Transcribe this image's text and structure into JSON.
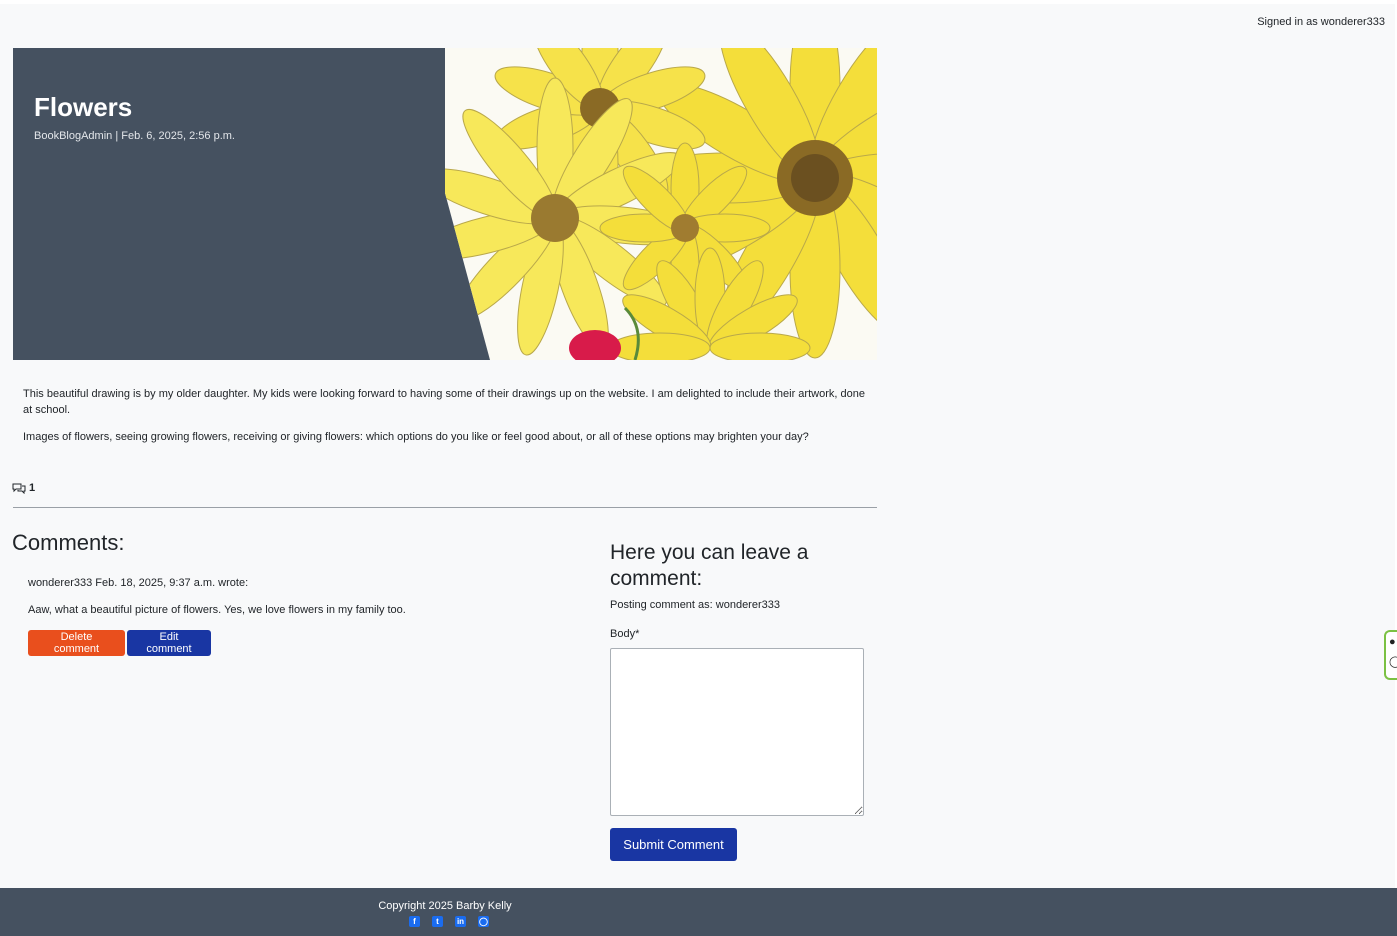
{
  "header": {
    "signed_in": "Signed in as wonderer333"
  },
  "post": {
    "title": "Flowers",
    "meta": "BookBlogAdmin | Feb. 6, 2025, 2:56 p.m.",
    "paragraphs": [
      "This beautiful drawing is by my older daughter. My kids were looking forward to having some of their drawings up on the website. I am delighted to include their artwork, done at school.",
      "Images of flowers, seeing growing flowers, receiving or giving flowers: which options do you like or feel good about, or all of these options may brighten your day?"
    ],
    "comment_count": "1"
  },
  "comments": {
    "heading": "Comments:",
    "items": [
      {
        "author_line": "wonderer333 Feb. 18, 2025, 9:37 a.m. wrote:",
        "text": "Aaw, what a beautiful picture of flowers. Yes, we love flowers in my family too.",
        "delete_label": "Delete comment",
        "edit_label": "Edit comment"
      }
    ]
  },
  "comment_form": {
    "heading": "Here you can leave a comment:",
    "posting_as": "Posting comment as: wonderer333",
    "body_label": "Body*",
    "body_value": "",
    "submit_label": "Submit Comment"
  },
  "footer": {
    "copyright": "Copyright 2025 Barby Kelly",
    "social_icons": [
      "facebook-icon",
      "twitter-icon",
      "linkedin-icon",
      "instagram-icon"
    ]
  },
  "colors": {
    "hero_bg": "#455160",
    "delete_button": "#e94f1d",
    "primary_button": "#1936a3",
    "footer_bg": "#455160",
    "flower_yellow": "#f4de3a"
  }
}
